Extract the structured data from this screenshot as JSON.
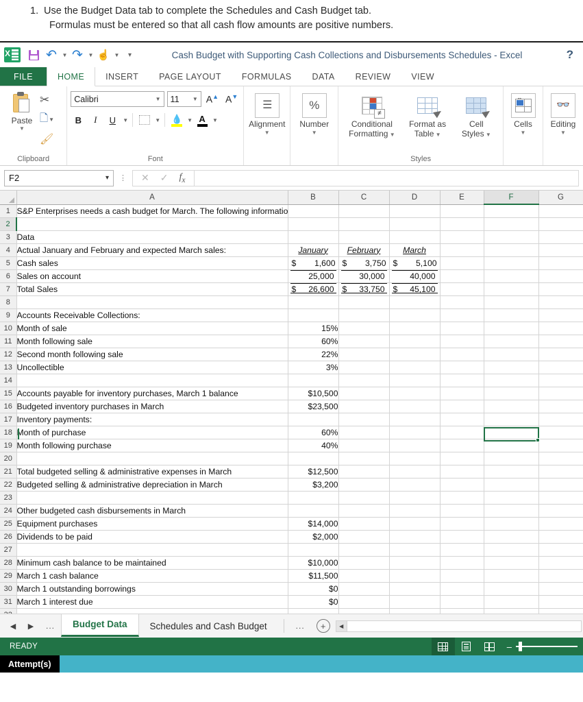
{
  "instruction": {
    "number": "1.",
    "line1": "Use the Budget Data tab to complete the Schedules and Cash Budget tab.",
    "line2": "Formulas must be entered so that all cash flow amounts are positive numbers."
  },
  "titlebar": {
    "app_icon": "excel-logo-icon",
    "save_icon": "save-icon",
    "undo_icon": "undo-icon",
    "redo_icon": "redo-icon",
    "touch_mode_icon": "touch-mode-icon",
    "customize_qat_icon": "customize-quick-access-toolbar-icon",
    "title": "Cash Budget with Supporting Cash Collections and Disbursements Schedules - Excel",
    "help": "?"
  },
  "ribbon": {
    "tabs": [
      {
        "label": "FILE",
        "active": false,
        "file": true
      },
      {
        "label": "HOME",
        "active": true,
        "file": false
      },
      {
        "label": "INSERT",
        "active": false,
        "file": false
      },
      {
        "label": "PAGE LAYOUT",
        "active": false,
        "file": false
      },
      {
        "label": "FORMULAS",
        "active": false,
        "file": false
      },
      {
        "label": "DATA",
        "active": false,
        "file": false
      },
      {
        "label": "REVIEW",
        "active": false,
        "file": false
      },
      {
        "label": "VIEW",
        "active": false,
        "file": false
      }
    ],
    "clipboard": {
      "group_label": "Clipboard",
      "paste_label": "Paste",
      "cut_icon": "scissors-icon",
      "copy_icon": "copy-icon",
      "format_painter_icon": "format-painter-icon"
    },
    "font": {
      "group_label": "Font",
      "font_name": "Calibri",
      "font_size": "11",
      "grow_font": "A",
      "shrink_font": "A",
      "bold": "B",
      "italic": "I",
      "underline": "U",
      "borders_icon": "borders-icon",
      "fill_color_icon": "fill-color-icon",
      "font_color_icon": "font-color-icon"
    },
    "alignment": {
      "label": "Alignment",
      "icon": "alignment-icon"
    },
    "number": {
      "label": "Number",
      "icon": "percent-icon"
    },
    "styles": {
      "group_label": "Styles",
      "conditional_formatting": "Conditional\nFormatting",
      "conditional_line1": "Conditional",
      "conditional_line2": "Formatting",
      "format_as_line1": "Format as",
      "format_as_line2": "Table",
      "cell_styles_line1": "Cell",
      "cell_styles_line2": "Styles"
    },
    "cells": {
      "label": "Cells",
      "icon": "cells-icon"
    },
    "editing": {
      "label": "Editing",
      "icon": "binoculars-icon"
    }
  },
  "formula_bar": {
    "name_box": "F2",
    "cancel_icon": "cancel-icon",
    "enter_icon": "confirm-icon",
    "function_icon": "insert-function-icon",
    "formula_value": ""
  },
  "grid": {
    "columns": [
      "A",
      "B",
      "C",
      "D",
      "E",
      "F",
      "G"
    ],
    "selected_column": "F",
    "selected_row": 2,
    "rows": [
      {
        "n": 1,
        "a": "S&P Enterprises needs a cash budget for March. The following information is available.",
        "b": "",
        "c": "",
        "d": ""
      },
      {
        "n": 2,
        "a": "",
        "b": "",
        "c": "",
        "d": ""
      },
      {
        "n": 3,
        "a": "Data",
        "b": "",
        "c": "",
        "d": "",
        "style": "bold"
      },
      {
        "n": 4,
        "a": "Actual January and February and expected March sales:",
        "b": "",
        "c": "",
        "d": ""
      },
      {
        "n": 5,
        "a": "Cash sales",
        "b": "$        1,600",
        "c": "$        3,750",
        "d": "$      5,100"
      },
      {
        "n": 6,
        "a": "Sales on account",
        "b": "25,000",
        "c": "30,000",
        "d": "40,000"
      },
      {
        "n": 7,
        "a": "Total Sales",
        "b": "$    26,600",
        "c": "$    33,750",
        "d": "$    45,100"
      },
      {
        "n": 8,
        "a": "",
        "b": "",
        "c": "",
        "d": ""
      },
      {
        "n": 9,
        "a": "Accounts Receivable Collections:",
        "b": "",
        "c": "",
        "d": ""
      },
      {
        "n": 10,
        "a": "Month of sale",
        "b": "15%",
        "c": "",
        "d": "",
        "indent": true
      },
      {
        "n": 11,
        "a": "Month following sale",
        "b": "60%",
        "c": "",
        "d": "",
        "indent": true
      },
      {
        "n": 12,
        "a": "Second month following sale",
        "b": "22%",
        "c": "",
        "d": "",
        "indent": true
      },
      {
        "n": 13,
        "a": "Uncollectible",
        "b": "3%",
        "c": "",
        "d": "",
        "indent": true
      },
      {
        "n": 14,
        "a": "",
        "b": "",
        "c": "",
        "d": ""
      },
      {
        "n": 15,
        "a": "Accounts payable for inventory purchases, March 1 balance",
        "b": "$10,500",
        "c": "",
        "d": ""
      },
      {
        "n": 16,
        "a": "Budgeted inventory purchases in March",
        "b": "$23,500",
        "c": "",
        "d": ""
      },
      {
        "n": 17,
        "a": "Inventory payments:",
        "b": "",
        "c": "",
        "d": ""
      },
      {
        "n": 18,
        "a": "Month of purchase",
        "b": "60%",
        "c": "",
        "d": "",
        "indent": true
      },
      {
        "n": 19,
        "a": "Month following purchase",
        "b": "40%",
        "c": "",
        "d": "",
        "indent": true
      },
      {
        "n": 20,
        "a": "",
        "b": "",
        "c": "",
        "d": ""
      },
      {
        "n": 21,
        "a": "Total budgeted selling & administrative expenses in March",
        "b": "$12,500",
        "c": "",
        "d": ""
      },
      {
        "n": 22,
        "a": "Budgeted selling & administrative depreciation in March",
        "b": "$3,200",
        "c": "",
        "d": ""
      },
      {
        "n": 23,
        "a": "",
        "b": "",
        "c": "",
        "d": ""
      },
      {
        "n": 24,
        "a": "Other budgeted cash disbursements in March",
        "b": "",
        "c": "",
        "d": ""
      },
      {
        "n": 25,
        "a": "Equipment purchases",
        "b": "$14,000",
        "c": "",
        "d": "",
        "indent": true
      },
      {
        "n": 26,
        "a": "Dividends to be paid",
        "b": "$2,000",
        "c": "",
        "d": "",
        "indent": true
      },
      {
        "n": 27,
        "a": "",
        "b": "",
        "c": "",
        "d": ""
      },
      {
        "n": 28,
        "a": "Minimum cash balance to be maintained",
        "b": "$10,000",
        "c": "",
        "d": ""
      },
      {
        "n": 29,
        "a": "March 1 cash balance",
        "b": "$11,500",
        "c": "",
        "d": ""
      },
      {
        "n": 30,
        "a": "March 1 outstanding borrowings",
        "b": "$0",
        "c": "",
        "d": ""
      },
      {
        "n": 31,
        "a": "March 1 interest due",
        "b": "$0",
        "c": "",
        "d": ""
      },
      {
        "n": 32,
        "a": "",
        "b": "",
        "c": "",
        "d": ""
      }
    ],
    "month_headers": {
      "january": "January",
      "february": "February",
      "march": "March"
    },
    "row5": {
      "b_sym": "$",
      "b_val": "1,600",
      "c_sym": "$",
      "c_val": "3,750",
      "d_sym": "$",
      "d_val": "5,100"
    },
    "row6": {
      "b_val": "25,000",
      "c_val": "30,000",
      "d_val": "40,000"
    },
    "row7": {
      "b_sym": "$",
      "b_val": "26,600",
      "c_sym": "$",
      "c_val": "33,750",
      "d_sym": "$",
      "d_val": "45,100"
    }
  },
  "tabbar": {
    "prev_icon": "previous-sheet-icon",
    "next_icon": "next-sheet-icon",
    "left_dots": "...",
    "tabs": [
      {
        "label": "Budget Data",
        "active": true
      },
      {
        "label": "Schedules and Cash Budget",
        "active": false
      }
    ],
    "right_dots": "...",
    "new_sheet": "+",
    "scroll_left_icon": "scroll-left-icon"
  },
  "statusbar": {
    "text": "READY",
    "normal_view_icon": "normal-view-icon",
    "page_layout_icon": "page-layout-view-icon",
    "page_break_icon": "page-break-preview-icon",
    "zoom_out": "–"
  },
  "attempts": {
    "label": "Attempt(s)"
  },
  "colors": {
    "excel_green": "#217346",
    "title_blue": "#3d5a78",
    "attempts_bar": "#44b3c8",
    "selection_green": "#217346"
  }
}
